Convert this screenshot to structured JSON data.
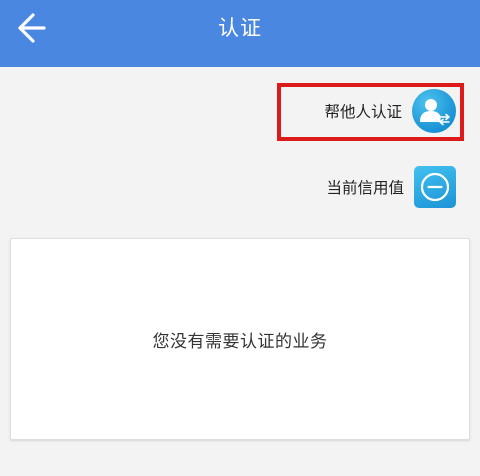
{
  "header": {
    "title": "认证",
    "back_icon": "arrow-left-icon",
    "background_color": "#4a87e0"
  },
  "actions": {
    "help_others": {
      "label": "帮他人认证",
      "icon": "user-switch-icon"
    },
    "credit_score": {
      "label": "当前信用值",
      "icon": "credit-gauge-icon"
    }
  },
  "empty_state": {
    "message": "您没有需要认证的业务"
  },
  "colors": {
    "accent": "#1a92d6",
    "highlight": "#dd1a1a"
  }
}
